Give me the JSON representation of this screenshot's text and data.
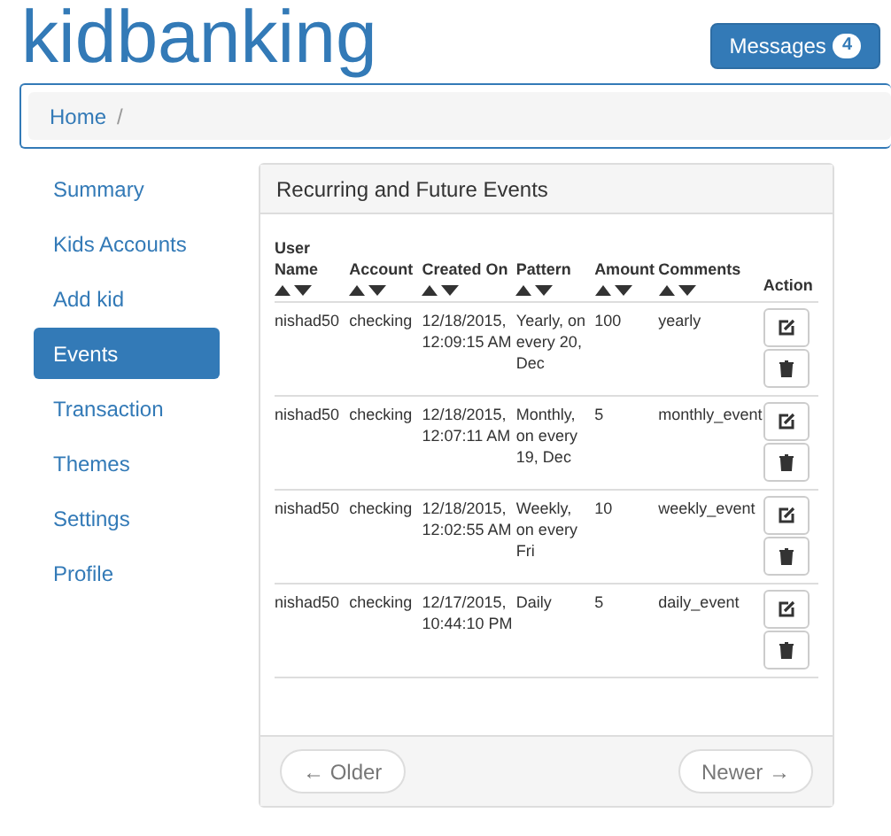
{
  "brand": "kidbanking",
  "messages_button": {
    "label": "Messages",
    "count": "4"
  },
  "breadcrumb": [
    {
      "label": "Home"
    },
    {
      "label": "/"
    }
  ],
  "sidebar": {
    "items": [
      {
        "label": "Summary",
        "selected": false
      },
      {
        "label": "Kids Accounts",
        "selected": false
      },
      {
        "label": "Add kid",
        "selected": false
      },
      {
        "label": "Events",
        "selected": true
      },
      {
        "label": "Transaction",
        "selected": false
      },
      {
        "label": "Themes",
        "selected": false
      },
      {
        "label": "Settings",
        "selected": false
      },
      {
        "label": "Profile",
        "selected": false
      }
    ]
  },
  "panel": {
    "title": "Recurring and Future Events",
    "table": {
      "columns": [
        {
          "label": "User Name",
          "sortable": true
        },
        {
          "label": "Account",
          "sortable": true
        },
        {
          "label": "Created On",
          "sortable": true
        },
        {
          "label": "Pattern",
          "sortable": true
        },
        {
          "label": "Amount",
          "sortable": true
        },
        {
          "label": "Comments",
          "sortable": true
        },
        {
          "label": "Action",
          "sortable": false
        }
      ],
      "rows": [
        {
          "cells": [
            "nishad50",
            "checking",
            "12/18/2015, 12:09:15 AM",
            "Yearly, on every 20, Dec",
            "100",
            "yearly"
          ]
        },
        {
          "cells": [
            "nishad50",
            "checking",
            "12/18/2015, 12:07:11 AM",
            "Monthly, on every 19, Dec",
            "5",
            "monthly_event"
          ]
        },
        {
          "cells": [
            "nishad50",
            "checking",
            "12/18/2015, 12:02:55 AM",
            "Weekly, on every Fri",
            "10",
            "weekly_event"
          ]
        },
        {
          "cells": [
            "nishad50",
            "checking",
            "12/17/2015, 10:44:10 PM",
            "Daily",
            "5",
            "daily_event"
          ]
        }
      ]
    },
    "pager": {
      "older": "← Older",
      "newer": "Newer →"
    }
  }
}
